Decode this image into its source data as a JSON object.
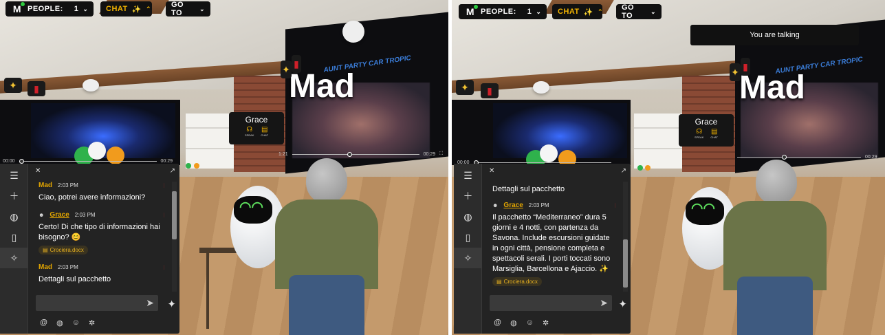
{
  "topbar": {
    "people_label": "PEOPLE:",
    "people_count": "1",
    "chat_label": "CHAT",
    "goto_label": "GO TO",
    "logo_letter": "M"
  },
  "scene": {
    "screen_sign": "Mad",
    "tagline": "AUNT PARTY CAR TROPIC",
    "grace_card": {
      "name": "Grace",
      "speak_label": "SPEAK",
      "chat_label": "CHAT"
    }
  },
  "video": {
    "left_time_start": "00:00",
    "left_time_end": "00:29",
    "mid_time_start": "1:21",
    "mid_time_end": "00:29",
    "counter": "0"
  },
  "notification": {
    "text": "You are talking"
  },
  "left_chat": {
    "messages": [
      {
        "author": "Mad",
        "time": "2:03 PM",
        "text": "Ciao, potrei avere informazioni?"
      },
      {
        "author": "Grace",
        "time": "2:03 PM",
        "text": "Certo! Di che tipo di informazioni hai bisogno? 😊",
        "attachment": "Crociera.docx"
      },
      {
        "author": "Mad",
        "time": "2:03 PM",
        "text": "Dettagli sul pacchetto"
      }
    ]
  },
  "right_chat": {
    "prior_text": "Dettagli sul pacchetto",
    "messages": [
      {
        "author": "Grace",
        "time": "2:03 PM",
        "text": "Il pacchetto “Mediterraneo” dura 5 giorni e 4 notti, con partenza da Savona. Include escursioni guidate in ogni città, pensione completa e spettacoli serali. I porti toccati sono Marsiglia, Barcellona e Ajaccio. ✨",
        "attachment": "Crociera.docx"
      }
    ]
  },
  "icons": {
    "menu": "hamburger-icon",
    "add": "plus-icon",
    "globe": "globe-icon",
    "phone": "phone-icon",
    "ai": "sparkle-icon",
    "mention": "at-icon",
    "translate": "globe-icon",
    "emoji": "emoji-icon",
    "settings": "gear-icon",
    "send": "send-icon"
  },
  "colors": {
    "accent": "#e2a500",
    "panel": "#232323",
    "delete": "#e02020",
    "status_dot": "#2ecc40"
  }
}
